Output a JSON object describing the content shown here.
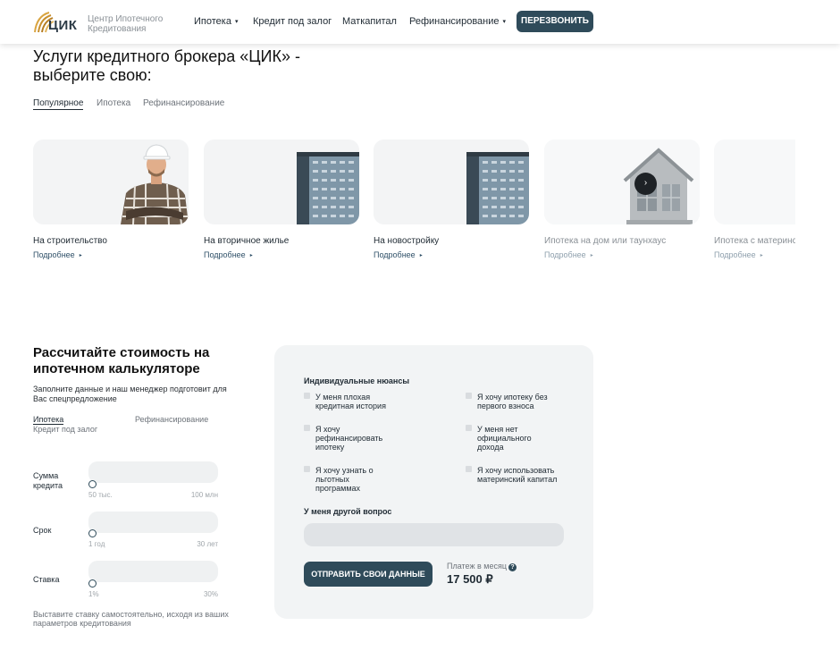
{
  "header": {
    "logo_text": "ЦИК",
    "brand_line1": "Центр Ипотечного",
    "brand_line2": "Кредитования",
    "nav": [
      {
        "label": "Ипотека",
        "has_dropdown": true
      },
      {
        "label": "Кредит под залог",
        "has_dropdown": false
      },
      {
        "label": "Маткапитал",
        "has_dropdown": false
      },
      {
        "label": "Рефинансирование",
        "has_dropdown": true
      }
    ],
    "callback_label": "ПЕРЕЗВОНИТЬ",
    "dropdown_icon": "▾"
  },
  "services": {
    "title": "Услуги кредитного брокера «ЦИК» - выберите свою:",
    "tabs": [
      "Популярное",
      "Ипотека",
      "Рефинансирование"
    ],
    "active_tab": "Популярное",
    "more_arrow_icon": "▸",
    "cards": [
      {
        "title": "На строительство",
        "more": "Подробнее",
        "image": "builder-worker-image"
      },
      {
        "title": "На вторичное жилье",
        "more": "Подробнее",
        "image": "apartment-tower-image"
      },
      {
        "title": "На новостройку",
        "more": "Подробнее",
        "image": "apartment-tower-image"
      },
      {
        "title": "Ипотека на дом или таунхаус",
        "more": "Подробнее",
        "image": "house-image"
      },
      {
        "title": "Ипотека с материнским",
        "more": "Подробнее",
        "image": "blank"
      }
    ],
    "next_icon": "›"
  },
  "calculator": {
    "title": "Рассчитайте стоимость на ипотечном калькуляторе",
    "subtitle": "Заполните данные и наш менеджер подготовит для Вас спецпредложение",
    "tabs": [
      "Ипотека",
      "Рефинансирование",
      "Кредит под залог"
    ],
    "active_tab": "Ипотека",
    "params": [
      {
        "label": "Сумма кредита",
        "min": "50 тыс.",
        "max": "100 млн",
        "position": 0
      },
      {
        "label": "Срок",
        "min": "1 год",
        "max": "30 лет",
        "position": 0
      },
      {
        "label": "Ставка",
        "min": "1%",
        "max": "30%",
        "position": 0
      }
    ],
    "note": "Выставите ставку самостоятельно, исходя из ваших параметров кредитования"
  },
  "panel": {
    "nuances_title": "Индивидуальные нюансы",
    "options": [
      "У меня плохая кредитная история",
      "Я хочу ипотеку без первого взноса",
      "Я хочу рефинансировать ипотеку",
      "У меня нет официального дохода",
      "Я хочу узнать о льготных программах",
      "Я хочу использовать материнский капитал"
    ],
    "question_title": "У меня другой вопрос",
    "question_value": "",
    "submit_label": "ОТПРАВИТЬ СВОИ ДАННЫЕ",
    "payment_label": "Платеж в месяц",
    "help_icon": "?",
    "payment_value": "17 500 ₽"
  }
}
